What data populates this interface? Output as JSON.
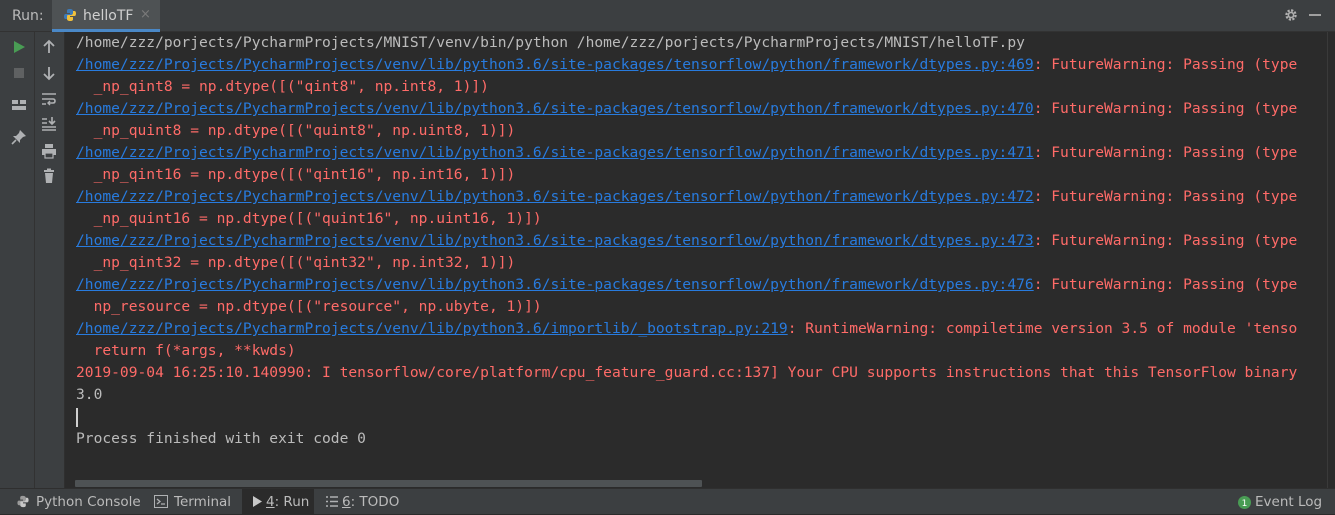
{
  "header": {
    "run_label": "Run:",
    "tab_title": "helloTF",
    "tab_close": "×",
    "tab_icon": "python-icon"
  },
  "toolbar_left": [
    "run-icon",
    "stop-icon",
    "layout-icon",
    "pin-icon"
  ],
  "toolbar_right": [
    "up-arrow-icon",
    "down-arrow-icon",
    "soft-wrap-icon",
    "scroll-to-end-icon",
    "print-icon",
    "trash-icon"
  ],
  "console": {
    "lines": [
      {
        "parts": [
          {
            "t": "/home/zzz/porjects/PycharmProjects/MNIST/venv/bin/python /home/zzz/porjects/PycharmProjects/MNIST/helloTF.py",
            "c": "plain"
          }
        ]
      },
      {
        "parts": [
          {
            "t": "/home/zzz/Projects/PycharmProjects/venv/lib/python3.6/site-packages/tensorflow/python/framework/dtypes.py:469",
            "c": "link"
          },
          {
            "t": ": FutureWarning: Passing (type",
            "c": "err"
          }
        ]
      },
      {
        "parts": [
          {
            "t": "  _np_qint8 = np.dtype([(\"qint8\", np.int8, 1)])",
            "c": "err"
          }
        ]
      },
      {
        "parts": [
          {
            "t": "/home/zzz/Projects/PycharmProjects/venv/lib/python3.6/site-packages/tensorflow/python/framework/dtypes.py:470",
            "c": "link"
          },
          {
            "t": ": FutureWarning: Passing (type",
            "c": "err"
          }
        ]
      },
      {
        "parts": [
          {
            "t": "  _np_quint8 = np.dtype([(\"quint8\", np.uint8, 1)])",
            "c": "err"
          }
        ]
      },
      {
        "parts": [
          {
            "t": "/home/zzz/Projects/PycharmProjects/venv/lib/python3.6/site-packages/tensorflow/python/framework/dtypes.py:471",
            "c": "link"
          },
          {
            "t": ": FutureWarning: Passing (type",
            "c": "err"
          }
        ]
      },
      {
        "parts": [
          {
            "t": "  _np_qint16 = np.dtype([(\"qint16\", np.int16, 1)])",
            "c": "err"
          }
        ]
      },
      {
        "parts": [
          {
            "t": "/home/zzz/Projects/PycharmProjects/venv/lib/python3.6/site-packages/tensorflow/python/framework/dtypes.py:472",
            "c": "link"
          },
          {
            "t": ": FutureWarning: Passing (type",
            "c": "err"
          }
        ]
      },
      {
        "parts": [
          {
            "t": "  _np_quint16 = np.dtype([(\"quint16\", np.uint16, 1)])",
            "c": "err"
          }
        ]
      },
      {
        "parts": [
          {
            "t": "/home/zzz/Projects/PycharmProjects/venv/lib/python3.6/site-packages/tensorflow/python/framework/dtypes.py:473",
            "c": "link"
          },
          {
            "t": ": FutureWarning: Passing (type",
            "c": "err"
          }
        ]
      },
      {
        "parts": [
          {
            "t": "  _np_qint32 = np.dtype([(\"qint32\", np.int32, 1)])",
            "c": "err"
          }
        ]
      },
      {
        "parts": [
          {
            "t": "/home/zzz/Projects/PycharmProjects/venv/lib/python3.6/site-packages/tensorflow/python/framework/dtypes.py:476",
            "c": "link"
          },
          {
            "t": ": FutureWarning: Passing (type",
            "c": "err"
          }
        ]
      },
      {
        "parts": [
          {
            "t": "  np_resource = np.dtype([(\"resource\", np.ubyte, 1)])",
            "c": "err"
          }
        ]
      },
      {
        "parts": [
          {
            "t": "/home/zzz/Projects/PycharmProjects/venv/lib/python3.6/importlib/_bootstrap.py:219",
            "c": "link"
          },
          {
            "t": ": RuntimeWarning: compiletime version 3.5 of module 'tenso",
            "c": "err"
          }
        ]
      },
      {
        "parts": [
          {
            "t": "  return f(*args, **kwds)",
            "c": "err"
          }
        ]
      },
      {
        "parts": [
          {
            "t": "2019-09-04 16:25:10.140990: I tensorflow/core/platform/cpu_feature_guard.cc:137] Your CPU supports instructions that this TensorFlow binary",
            "c": "err"
          }
        ]
      },
      {
        "parts": [
          {
            "t": "3.0",
            "c": "plain"
          }
        ]
      },
      {
        "parts": [
          {
            "t": "",
            "c": "plain"
          }
        ]
      },
      {
        "parts": [
          {
            "t": "Process finished with exit code 0",
            "c": "plain"
          }
        ]
      }
    ]
  },
  "bottombar": {
    "python_console": "Python Console",
    "terminal": "Terminal",
    "run_num": "4",
    "run_text": ": Run",
    "todo_num": "6",
    "todo_text": ": TODO",
    "event_log": "Event Log",
    "event_count": "1"
  },
  "colors": {
    "link": "#287bde",
    "error": "#ff6b68",
    "plain": "#bbbbbb",
    "accent": "#4a88c7",
    "run_green": "#499c54"
  }
}
